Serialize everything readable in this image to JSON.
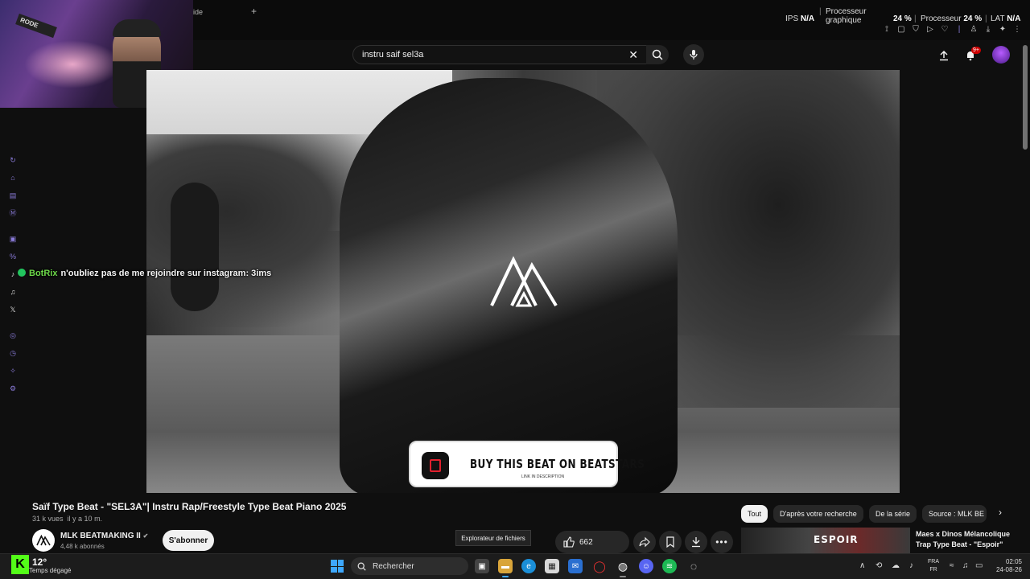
{
  "browser": {
    "tab_fragment": "ide",
    "new_tab": "+"
  },
  "stats": {
    "ips_label": "IPS",
    "ips_value": "N/A",
    "gpu_label": "Processeur graphique",
    "gpu_value": "24 %",
    "cpu_label": "Processeur",
    "cpu_value": "24 %",
    "lat_label": "LAT",
    "lat_value": "N/A"
  },
  "header": {
    "search_value": "instru saif sel3a",
    "notif_count": "9+"
  },
  "webcam": {
    "mic_brand": "RODE"
  },
  "chat": {
    "user": "BotRix",
    "message": "n'oubliez pas de me rejoindre sur instagram: 3ims"
  },
  "overlay": {
    "beatstars_title": "BUY THIS BEAT ON BEATSTARS",
    "beatstars_sub": "LINK IN DESCRIPTION"
  },
  "video": {
    "title": "Saïf Type Beat - \"SEL3A\"| Instru Rap/Freestyle Type Beat Piano 2025",
    "views": "31 k vues",
    "age": "il y a 10 m.",
    "channel_name": "MLK BEATMAKING II",
    "subscribers": "4,48 k abonnés",
    "subscribe_label": "S'abonner",
    "like_count": "662"
  },
  "tooltip": "Explorateur de fichiers",
  "chips": [
    "Tout",
    "D'après votre recherche",
    "De la série",
    "Source : MLK BE"
  ],
  "recommended": {
    "thumb_text": "ESPOIR",
    "title": "Maes x Dinos Mélancolique Trap Type Beat - \"Espoir\""
  },
  "taskbar": {
    "kick_letter": "K",
    "weather_temp": "12°",
    "weather_desc": "Temps dégagé",
    "search_label": "Rechercher",
    "lang_1": "FRA",
    "lang_2": "FR",
    "time": "02:05",
    "date": "24-08-26"
  },
  "colors": {
    "kick_green": "#53fc18",
    "chat_user": "#6dd94a",
    "accent_purple": "#8a7bd8",
    "notification_red": "#cc0000"
  }
}
